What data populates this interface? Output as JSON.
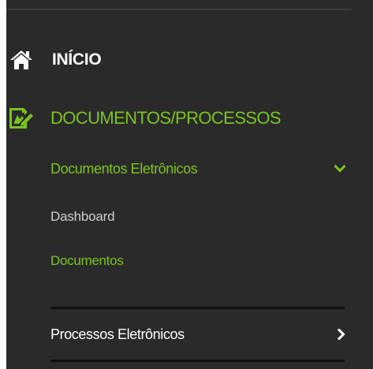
{
  "sidebar": {
    "accent_color": "#7bc41f",
    "background_color": "#2a2a2a",
    "items": [
      {
        "label": "INÍCIO",
        "icon": "home-icon"
      },
      {
        "label": "DOCUMENTOS/PROCESSOS",
        "icon": "document-edit-icon",
        "active": true
      }
    ],
    "submenu": {
      "label": "Documentos Eletrônicos",
      "icon": "chevron-down-icon",
      "expanded": true,
      "children": [
        {
          "label": "Dashboard",
          "active": false
        },
        {
          "label": "Documentos",
          "active": true
        }
      ]
    },
    "submenu_collapsed": {
      "label": "Processos Eletrônicos",
      "icon": "chevron-right-icon",
      "expanded": false
    }
  }
}
